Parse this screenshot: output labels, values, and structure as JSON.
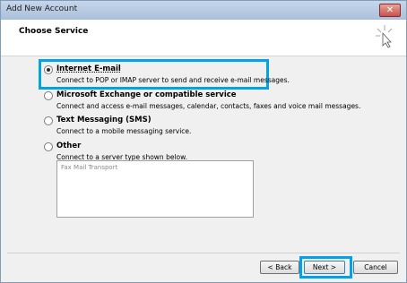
{
  "window": {
    "title": "Add New Account",
    "close_label": "✕"
  },
  "header": {
    "title": "Choose Service"
  },
  "options": [
    {
      "label": "Internet E-mail",
      "description": "Connect to POP or IMAP server to send and receive e-mail messages.",
      "selected": true
    },
    {
      "label": "Microsoft Exchange or compatible service",
      "description": "Connect and access e-mail messages, calendar, contacts, faxes and voice mail messages.",
      "selected": false
    },
    {
      "label": "Text Messaging (SMS)",
      "description": "Connect to a mobile messaging service.",
      "selected": false
    },
    {
      "label": "Other",
      "description": "Connect to a server type shown below.",
      "selected": false
    }
  ],
  "other_list": {
    "items": [
      "Fax Mail Transport"
    ]
  },
  "buttons": {
    "back": "< Back",
    "next": "Next >",
    "cancel": "Cancel"
  },
  "colors": {
    "highlight": "#00a2e8",
    "titlebar": "#b8cce4"
  }
}
